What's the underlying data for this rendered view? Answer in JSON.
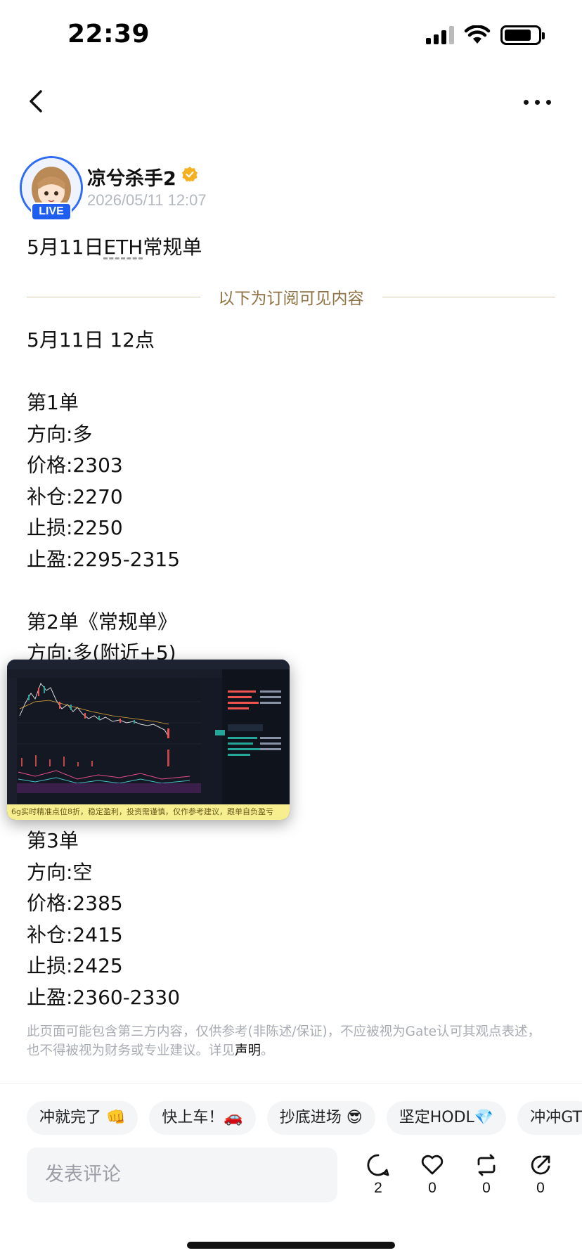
{
  "status_bar": {
    "time": "22:39"
  },
  "author": {
    "name": "凉兮杀手2",
    "post_time": "2026/05/11 12:07",
    "live_label": "LIVE"
  },
  "post": {
    "title_pre": "5月11日",
    "title_link": "ETH",
    "title_post": "常规单",
    "subscriber_divider": "以下为订阅可见内容",
    "lines_top": [
      "5月11日 12点",
      "",
      "第1单",
      "方向:多",
      "价格:2303",
      "补仓:2270",
      "止损:2250",
      "止盈:2295-2315",
      "",
      "第2单《常规单》",
      "方向:多(附近+5)"
    ],
    "lines_bottom": [
      "第3单",
      "方向:空",
      "价格:2385",
      "补仓:2415",
      "止损:2425",
      "止盈:2360-2330"
    ],
    "chart_caption": "6g实时精准点位8折，稳定盈利，投资需谨慎，仅作参考建议，跟单自负盈亏",
    "disclaimer": "此页面可能包含第三方内容，仅供参考(非陈述/保证)，不应被视为Gate认可其观点表述，也不得被视为财务或专业建议。详见",
    "disclaimer_link": "声明",
    "disclaimer_end": "。"
  },
  "reactions": [
    {
      "label": "冲就完了 👊"
    },
    {
      "label": "快上车！🚗"
    },
    {
      "label": "抄底进场 😎"
    },
    {
      "label": "坚定HODL💎"
    },
    {
      "label": "冲冲GT"
    }
  ],
  "comment": {
    "placeholder": "发表评论"
  },
  "action_counts": {
    "comments": "2",
    "likes": "0",
    "reposts": "0",
    "shares": "0"
  },
  "colors": {
    "accent_blue": "#1f5ef0",
    "divider_gold": "#8f7344",
    "verified": "#f5b021"
  }
}
